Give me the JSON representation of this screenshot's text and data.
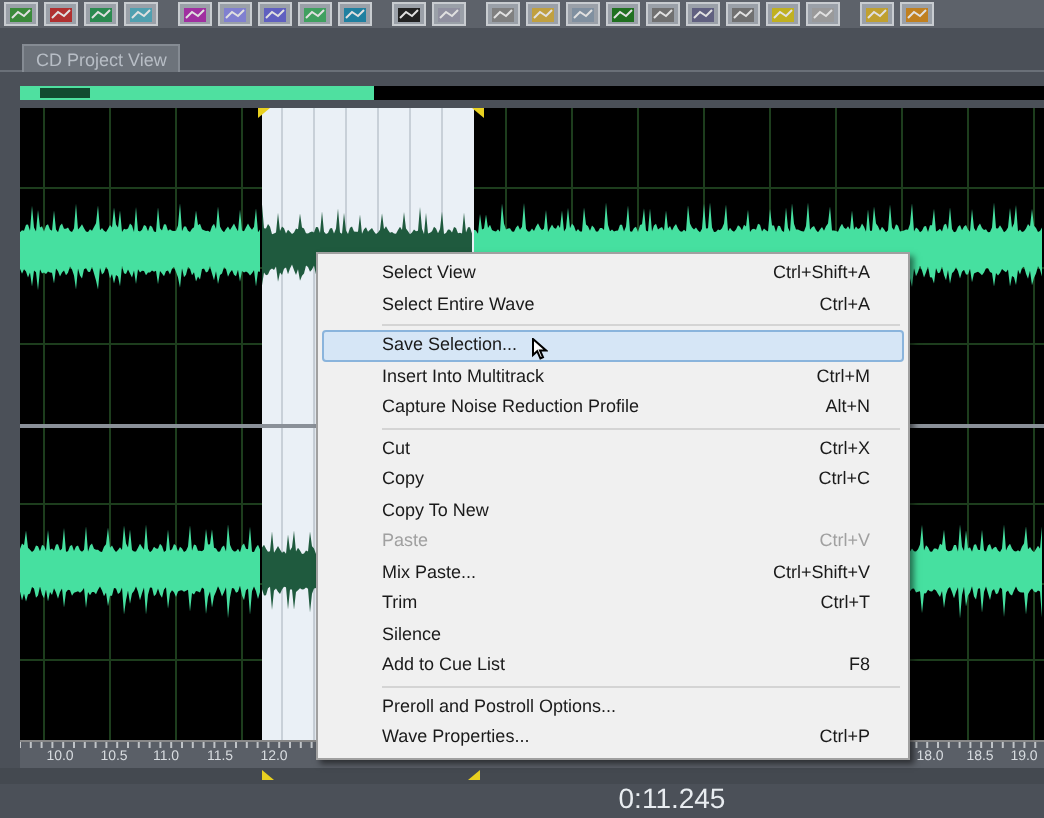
{
  "tabs": [
    {
      "label": "CD Project View"
    }
  ],
  "ruler": {
    "labels": [
      "10.0",
      "10.5",
      "11.0",
      "11.5",
      "12.0",
      "18.0",
      "18.5",
      "19.0"
    ]
  },
  "context_menu": [
    {
      "kind": "item",
      "label": "Select View",
      "shortcut": "Ctrl+Shift+A",
      "selected": false,
      "disabled": false
    },
    {
      "kind": "item",
      "label": "Select Entire Wave",
      "shortcut": "Ctrl+A",
      "selected": false,
      "disabled": false
    },
    {
      "kind": "separator"
    },
    {
      "kind": "item",
      "label": "Save Selection...",
      "selected": true,
      "disabled": false
    },
    {
      "kind": "item",
      "label": "Insert Into Multitrack",
      "shortcut": "Ctrl+M",
      "selected": false,
      "disabled": false
    },
    {
      "kind": "item",
      "label": "Capture Noise Reduction Profile",
      "shortcut": "Alt+N",
      "selected": false,
      "disabled": false
    },
    {
      "kind": "separator"
    },
    {
      "kind": "item",
      "label": "Cut",
      "shortcut": "Ctrl+X",
      "selected": false,
      "disabled": false
    },
    {
      "kind": "item",
      "label": "Copy",
      "shortcut": "Ctrl+C",
      "selected": false,
      "disabled": false
    },
    {
      "kind": "item",
      "label": "Copy To New",
      "selected": false,
      "disabled": false
    },
    {
      "kind": "item",
      "label": "Paste",
      "shortcut": "Ctrl+V",
      "selected": false,
      "disabled": true
    },
    {
      "kind": "item",
      "label": "Mix Paste...",
      "shortcut": "Ctrl+Shift+V",
      "selected": false,
      "disabled": false
    },
    {
      "kind": "item",
      "label": "Trim",
      "shortcut": "Ctrl+T",
      "selected": false,
      "disabled": false
    },
    {
      "kind": "item",
      "label": "Silence",
      "selected": false,
      "disabled": false
    },
    {
      "kind": "item",
      "label": "Add to Cue List",
      "shortcut": "F8",
      "selected": false,
      "disabled": false
    },
    {
      "kind": "separator"
    },
    {
      "kind": "item",
      "label": "Preroll and Postroll Options...",
      "selected": false,
      "disabled": false
    },
    {
      "kind": "item",
      "label": "Wave Properties...",
      "shortcut": "Ctrl+P",
      "selected": false,
      "disabled": false
    }
  ],
  "time_display": "0:11.245"
}
